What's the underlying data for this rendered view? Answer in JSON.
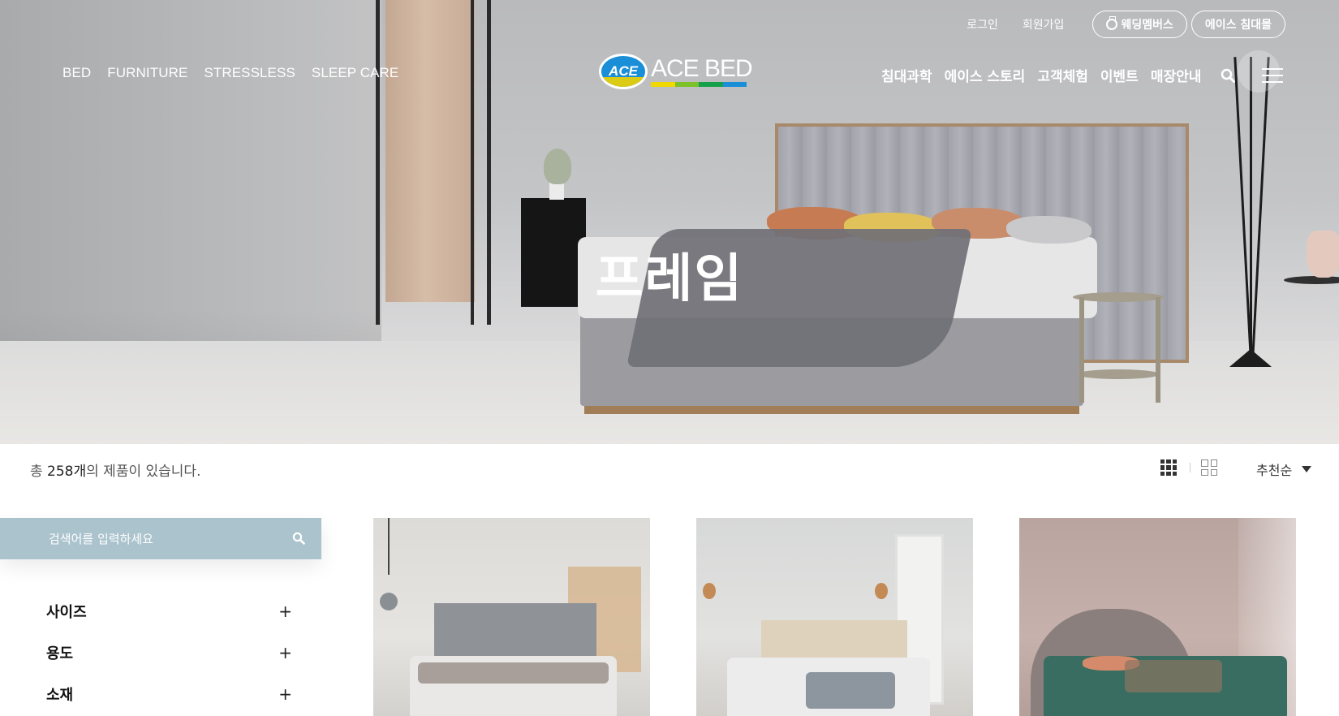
{
  "header": {
    "top_links": [
      "로그인",
      "회원가입"
    ],
    "pills": {
      "wedding": "웨딩멤버스",
      "store": "에이스 침대몰"
    },
    "nav_left": [
      "BED",
      "FURNITURE",
      "STRESSLESS",
      "SLEEP CARE"
    ],
    "nav_right": [
      "침대과학",
      "에이스 스토리",
      "고객체험",
      "이벤트",
      "매장안내"
    ],
    "logo": {
      "mark": "ACE",
      "text": "ACE BED",
      "bar_colors": [
        "#f0d800",
        "#7cc12a",
        "#17a04a",
        "#1a8fd8"
      ]
    }
  },
  "hero": {
    "title": "프레임"
  },
  "toolbar": {
    "count_prefix": "총 ",
    "count_value": "258개",
    "count_suffix": "의 제품이 있습니다.",
    "sort_label": "추천순"
  },
  "sidebar": {
    "search_placeholder": "검색어를 입력하세요",
    "filters": [
      "사이즈",
      "용도",
      "소재"
    ]
  },
  "colors": {
    "search_bg": "#abc3cd",
    "accent_blue": "#1a8fd8"
  },
  "icons": [
    "ring-icon",
    "search-icon",
    "menu-icon",
    "grid-3-icon",
    "grid-2-icon",
    "caret-down-icon",
    "plus-icon"
  ]
}
